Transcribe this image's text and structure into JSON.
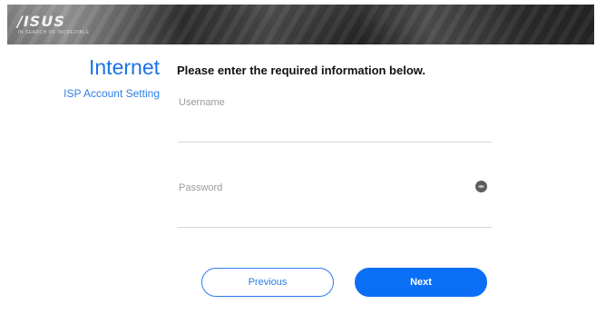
{
  "header": {
    "logo_text": "/ISUS",
    "logo_tagline": "IN SEARCH OF INCREDIBLE"
  },
  "section": {
    "title": "Internet",
    "subtitle": "ISP Account Setting"
  },
  "form": {
    "instruction": "Please enter the required information below.",
    "username": {
      "label": "Username",
      "value": ""
    },
    "password": {
      "label": "Password",
      "value": "",
      "toggle_icon": "eye-icon"
    }
  },
  "buttons": {
    "previous_label": "Previous",
    "next_label": "Next"
  },
  "colors": {
    "accent": "#1a73e8",
    "primary_button": "#0a6ff5"
  }
}
